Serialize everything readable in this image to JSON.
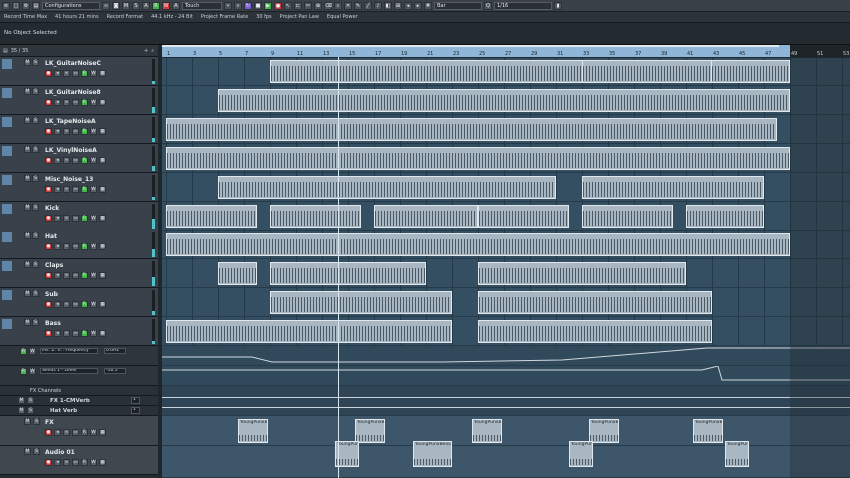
{
  "toolbar": {
    "config_label": "Configurations",
    "mode_label": "Touch",
    "btn_m": "M",
    "btn_s": "S",
    "btn_r": "R",
    "btn_w": "W",
    "btn_a": "A",
    "snap_label": "Bar",
    "quantize_label": "1/16"
  },
  "status": {
    "items": [
      "Record Time Max",
      "41 hours 21 mins",
      "Record Format",
      "44.1 kHz - 24 Bit",
      "Project Frame Rate",
      "30 fps",
      "Project Pan Law",
      "Equal Power"
    ]
  },
  "info_line": "No Object Selected",
  "track_header": {
    "count": "35 / 35"
  },
  "tracks": [
    {
      "name": "LK_GuitarNoiseC",
      "clips": [
        [
          9,
          49
        ],
        [
          33,
          43
        ]
      ]
    },
    {
      "name": "LK_GuitarNoise8",
      "clips": [
        [
          5,
          49
        ]
      ]
    },
    {
      "name": "LK_TapeNoiseA",
      "clips": [
        [
          1,
          48
        ]
      ]
    },
    {
      "name": "LK_VinylNoiseA",
      "clips": [
        [
          1,
          49
        ]
      ]
    },
    {
      "name": "Misc_Noise_13",
      "clips": [
        [
          5,
          31
        ],
        [
          33,
          47
        ]
      ]
    },
    {
      "name": "Kick",
      "clips": [
        [
          1,
          8
        ],
        [
          9,
          16
        ],
        [
          17,
          25
        ],
        [
          25,
          32
        ],
        [
          33,
          40
        ],
        [
          41,
          47
        ]
      ]
    },
    {
      "name": "Hat",
      "clips": [
        [
          1,
          49
        ]
      ]
    },
    {
      "name": "Claps",
      "clips": [
        [
          5,
          8
        ],
        [
          9,
          21
        ],
        [
          25,
          41
        ]
      ]
    },
    {
      "name": "Sub",
      "clips": [
        [
          9,
          23
        ],
        [
          25,
          43
        ]
      ]
    },
    {
      "name": "Bass",
      "clips": [
        [
          1,
          23
        ],
        [
          25,
          43
        ]
      ]
    }
  ],
  "automation": [
    {
      "param": "Ins. 2: V... Frequency",
      "value": "0.0Hz"
    },
    {
      "param": "Sends 1 - Level",
      "value": "-16.5"
    }
  ],
  "fx_folder": "FX Channels",
  "fx_channels": [
    {
      "name": "FX 1-CMVerb",
      "value": "1"
    },
    {
      "name": "Hat Verb",
      "value": "1"
    }
  ],
  "audio_tracks": [
    {
      "name": "FX",
      "clip_name": "YoungPunxBeoow!"
    },
    {
      "name": "Audio 01",
      "clip_name": "YoungPunxBeoow!"
    }
  ],
  "ruler_labels": [
    "1",
    "3",
    "5",
    "7",
    "9",
    "11",
    "13",
    "15",
    "17",
    "19",
    "21",
    "23",
    "25",
    "27",
    "29",
    "31",
    "33",
    "35",
    "37",
    "39",
    "41",
    "43",
    "45",
    "47",
    "49",
    "51",
    "53"
  ],
  "locator_end_label": "49"
}
